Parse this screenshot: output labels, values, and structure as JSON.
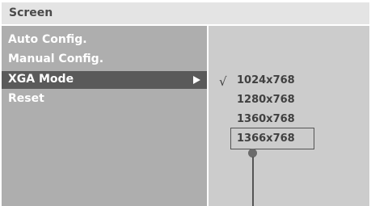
{
  "title": "Screen",
  "menu": {
    "items": [
      {
        "label": "Auto Config."
      },
      {
        "label": "Manual Config."
      },
      {
        "label": "XGA Mode"
      },
      {
        "label": "Reset"
      }
    ]
  },
  "submenu": {
    "check_glyph": "√",
    "options": [
      {
        "label": "1024x768"
      },
      {
        "label": "1280x768"
      },
      {
        "label": "1360x768"
      },
      {
        "label": "1366x768"
      }
    ]
  },
  "colors": {
    "title_bar": "#e4e4e4",
    "left_pane": "#aeaeae",
    "right_pane": "#cccccc",
    "selected_item": "#5a5a5a"
  },
  "icons": {
    "submenu_arrow": "arrow-right-icon",
    "checkmark": "checkmark-icon",
    "callout": "callout-pointer-icon"
  }
}
